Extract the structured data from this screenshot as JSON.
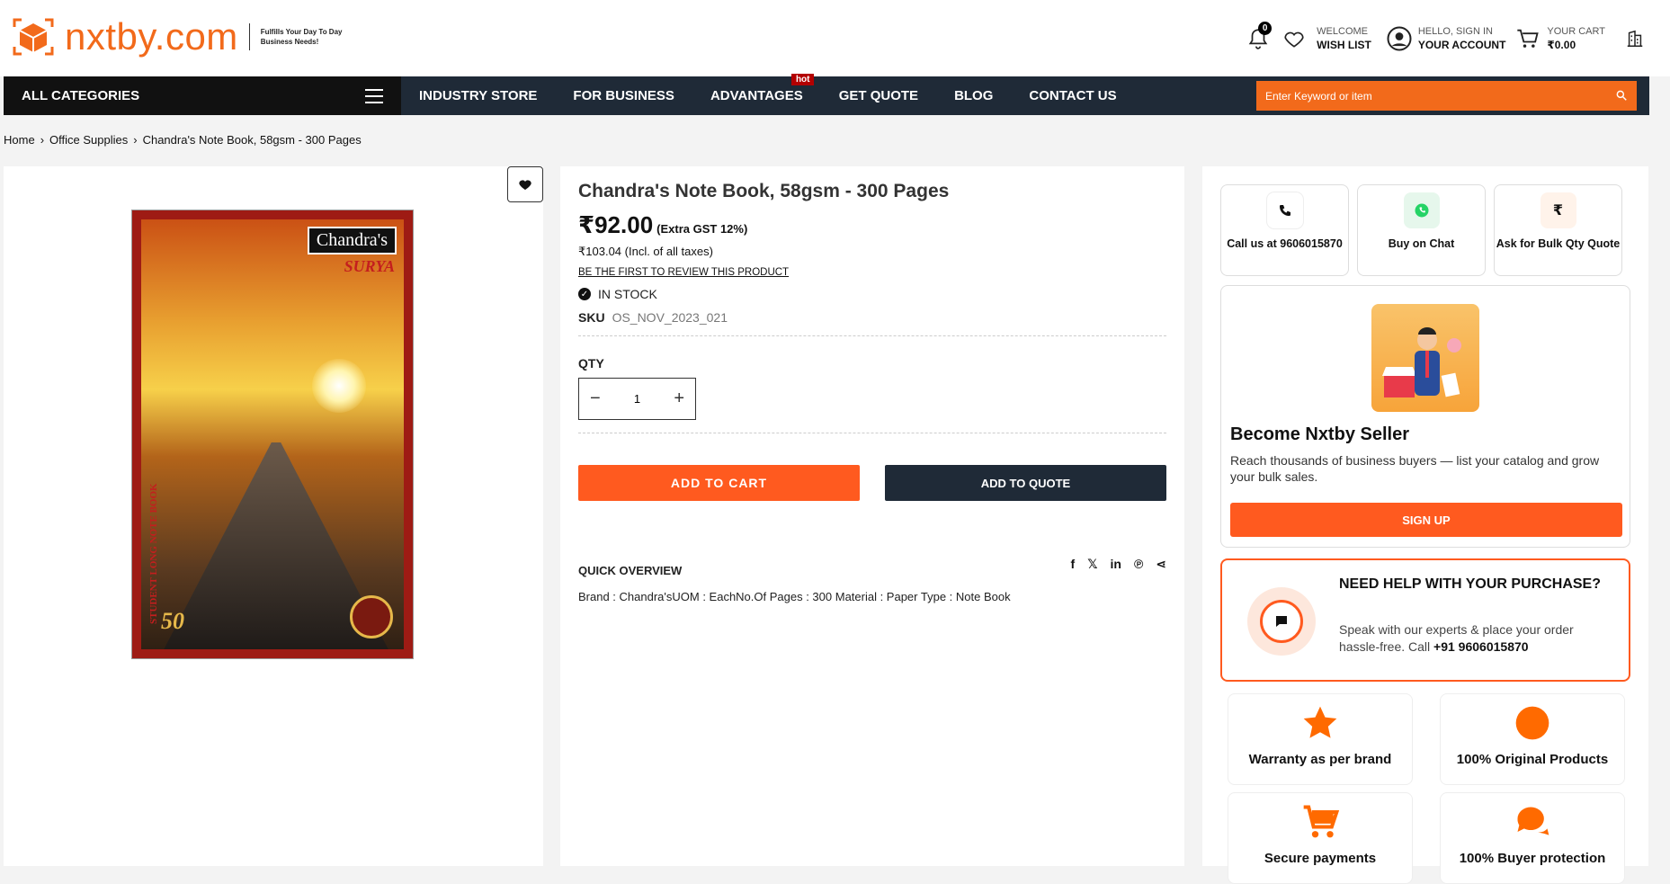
{
  "header": {
    "logo_text": "nxtby.com",
    "tagline": "Fulfills Your Day To Day Business Needs!",
    "notif_count": "0",
    "wishlist_top": "WELCOME",
    "wishlist_bottom": "WISH LIST",
    "account_top": "HELLO, SIGN IN",
    "account_bottom": "YOUR ACCOUNT",
    "cart_top": "YOUR CART",
    "cart_bottom": "₹0.00"
  },
  "nav": {
    "all_categories": "ALL CATEGORIES",
    "links": [
      "INDUSTRY STORE",
      "FOR BUSINESS",
      "ADVANTAGES",
      "GET QUOTE",
      "BLOG",
      "CONTACT US"
    ],
    "hot_label": "hot",
    "search_placeholder": "Enter Keyword or item"
  },
  "breadcrumb": [
    "Home",
    "Office Supplies",
    "Chandra's Note Book, 58gsm - 300 Pages"
  ],
  "product": {
    "title": "Chandra's Note Book, 58gsm - 300 Pages",
    "price": "₹92.00",
    "gst_note": "(Extra GST 12%)",
    "incl_price": "₹103.04 (Incl. of all taxes)",
    "review_link": "BE THE FIRST TO REVIEW THIS PRODUCT",
    "stock": "IN STOCK",
    "sku_label": "SKU",
    "sku": "OS_NOV_2023_021",
    "qty_label": "QTY",
    "qty": "1",
    "add_to_cart": "ADD TO CART",
    "add_to_quote": "ADD TO QUOTE",
    "overview_title": "QUICK OVERVIEW",
    "overview_text": "Brand : Chandra'sUOM : EachNo.Of Pages : 300 Material : Paper Type : Note Book",
    "book_brand": "Chandra's",
    "book_sub": "SURYA",
    "book_spine": "STUDENT LONG NOTE BOOK",
    "book_fifty": "50"
  },
  "side": {
    "call_label": "Call us at 9606015870",
    "chat_label": "Buy on Chat",
    "bulk_label": "Ask for Bulk Qty Quote",
    "seller_title": "Become Nxtby Seller",
    "seller_text": "Reach thousands of business buyers — list your catalog and grow your bulk sales.",
    "signup": "SIGN UP",
    "help_title": "NEED HELP WITH YOUR PURCHASE?",
    "help_text": "Speak with our experts & place your order hassle-free. Call",
    "help_phone": "+91 9606015870",
    "features": [
      "Warranty as per brand",
      "100% Original Products",
      "Secure payments",
      "100% Buyer protection"
    ]
  },
  "colors": {
    "accent": "#ff5a1f",
    "nav_bg": "#1f2a37"
  }
}
